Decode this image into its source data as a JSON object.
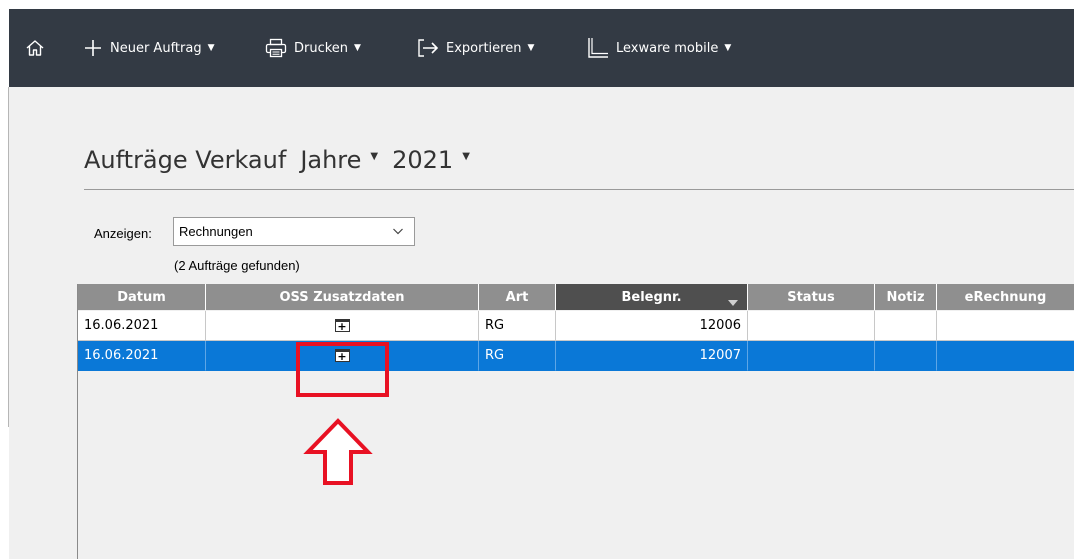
{
  "toolbar": {
    "home_icon": "home-icon",
    "items": [
      {
        "icon": "plus-icon",
        "label": "Neuer Auftrag"
      },
      {
        "icon": "printer-icon",
        "label": "Drucken"
      },
      {
        "icon": "export-icon",
        "label": "Exportieren"
      },
      {
        "icon": "lexware-mobile-icon",
        "label": "Lexware mobile"
      }
    ],
    "caret": "▼",
    "background": "#333a44"
  },
  "page": {
    "title": "Aufträge Verkauf",
    "period_type": "Jahre",
    "year": "2021",
    "caret": "▼"
  },
  "filter": {
    "label": "Anzeigen:",
    "selected": "Rechnungen",
    "found": "(2 Aufträge gefunden)"
  },
  "table": {
    "columns": [
      "Datum",
      "OSS Zusatzdaten",
      "Art",
      "Belegnr.",
      "Status",
      "Notiz",
      "eRechnung"
    ],
    "sorted_column": "Belegnr.",
    "rows": [
      {
        "datum": "16.06.2021",
        "oss": "+",
        "art": "RG",
        "belegnr": "12006",
        "status": "",
        "notiz": "",
        "erechnung": "",
        "selected": false
      },
      {
        "datum": "16.06.2021",
        "oss": "+",
        "art": "RG",
        "belegnr": "12007",
        "status": "",
        "notiz": "",
        "erechnung": "",
        "selected": true
      }
    ],
    "selection_color": "#0a78d7"
  },
  "annotation": {
    "highlight_color": "#e81123",
    "shapes": [
      "highlight-box",
      "up-arrow"
    ]
  }
}
